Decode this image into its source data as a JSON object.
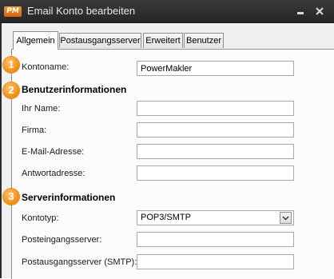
{
  "window": {
    "logo_text": "PM",
    "title": "Email Konto bearbeiten",
    "minimize_icon": "minimize-icon",
    "close_icon": "close-icon"
  },
  "tabs": [
    {
      "label": "Allgemein",
      "active": true
    },
    {
      "label": "Postausgangsserver",
      "active": false
    },
    {
      "label": "Erweitert",
      "active": false
    },
    {
      "label": "Benutzer",
      "active": false
    }
  ],
  "steps": [
    "1",
    "2",
    "3"
  ],
  "account": {
    "name_label": "Kontoname:",
    "name_value": "PowerMakler"
  },
  "user_info": {
    "heading": "Benutzerinformationen",
    "your_name_label": "Ihr Name:",
    "your_name_value": "",
    "company_label": "Firma:",
    "company_value": "",
    "email_label": "E-Mail-Adresse:",
    "email_value": "",
    "reply_label": "Antwortadresse:",
    "reply_value": ""
  },
  "server_info": {
    "heading": "Serverinformationen",
    "type_label": "Kontotyp:",
    "type_value": "POP3/SMTP",
    "incoming_label": "Posteingangsserver:",
    "incoming_value": "",
    "outgoing_label": "Postausgangsserver (SMTP):",
    "outgoing_value": ""
  },
  "colors": {
    "accent": "#f08a10",
    "titlebar": "#2b2b2b"
  }
}
